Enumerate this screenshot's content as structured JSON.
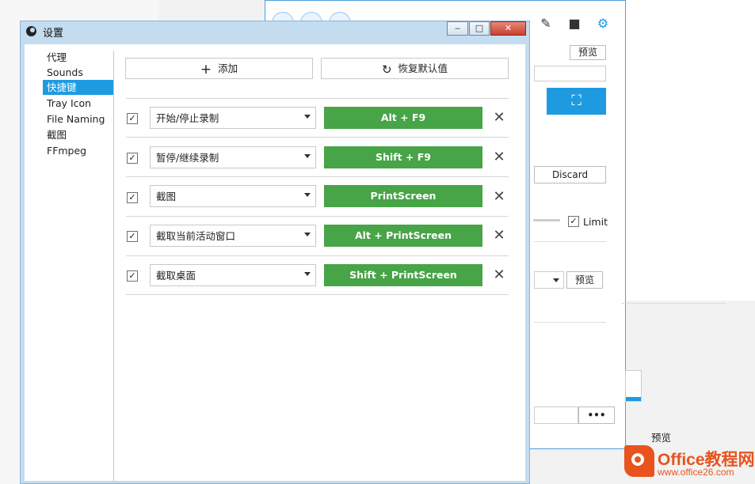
{
  "background": {
    "preview_label_1": "预览",
    "discard_label": "Discard",
    "limit_label": "Limit",
    "preview_label_2": "预览",
    "more_label": "•••",
    "preview_label_3": "预览"
  },
  "dialog": {
    "title": "设置",
    "minimize": "‒",
    "maximize": "□",
    "close": "✕"
  },
  "sidebar": {
    "items": [
      {
        "label": "代理"
      },
      {
        "label": "Sounds"
      },
      {
        "label": "快捷键"
      },
      {
        "label": "Tray Icon"
      },
      {
        "label": "File Naming"
      },
      {
        "label": "截图"
      },
      {
        "label": "FFmpeg"
      }
    ],
    "selected_index": 2
  },
  "toolbar": {
    "add_label": "添加",
    "add_icon": "plus-icon",
    "reset_label": "恢复默认值",
    "reset_icon": "refresh-icon"
  },
  "hotkeys": [
    {
      "checked": true,
      "action": "开始/停止录制",
      "key": "Alt + F9"
    },
    {
      "checked": true,
      "action": "暂停/继续录制",
      "key": "Shift + F9"
    },
    {
      "checked": true,
      "action": "截图",
      "key": "PrintScreen"
    },
    {
      "checked": true,
      "action": "截取当前活动窗口",
      "key": "Alt + PrintScreen"
    },
    {
      "checked": true,
      "action": "截取桌面",
      "key": "Shift + PrintScreen"
    }
  ],
  "colors": {
    "accent": "#1e9be0",
    "key_button": "#47a447"
  },
  "watermark": {
    "title": "Office教程网",
    "url": "www.office26.com"
  }
}
